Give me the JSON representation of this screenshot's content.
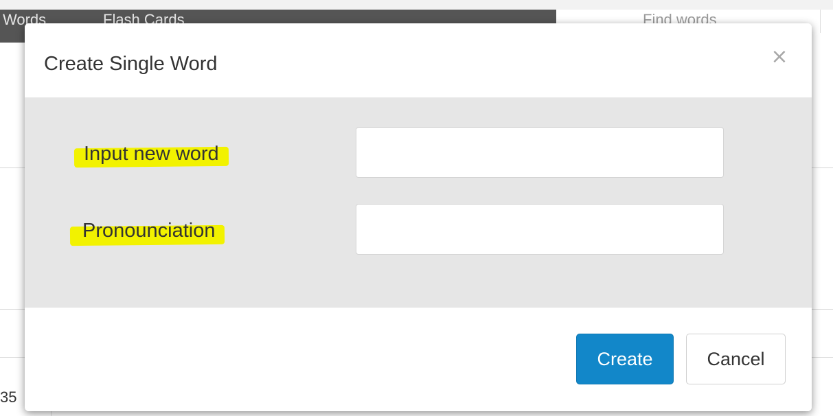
{
  "background": {
    "nav_items": [
      "Words",
      "Flash Cards"
    ],
    "search_placeholder": "Find words",
    "cell_text": "35"
  },
  "modal": {
    "title": "Create Single Word",
    "close_label": "×",
    "fields": {
      "word_label": "Input new word",
      "word_value": "",
      "pronunciation_label": "Pronounciation",
      "pronunciation_value": ""
    },
    "buttons": {
      "create_label": "Create",
      "cancel_label": "Cancel"
    }
  },
  "colors": {
    "primary": "#1287c9",
    "highlight": "#f2f200",
    "navbar": "#555555",
    "body_bg": "#e6e6e6"
  }
}
